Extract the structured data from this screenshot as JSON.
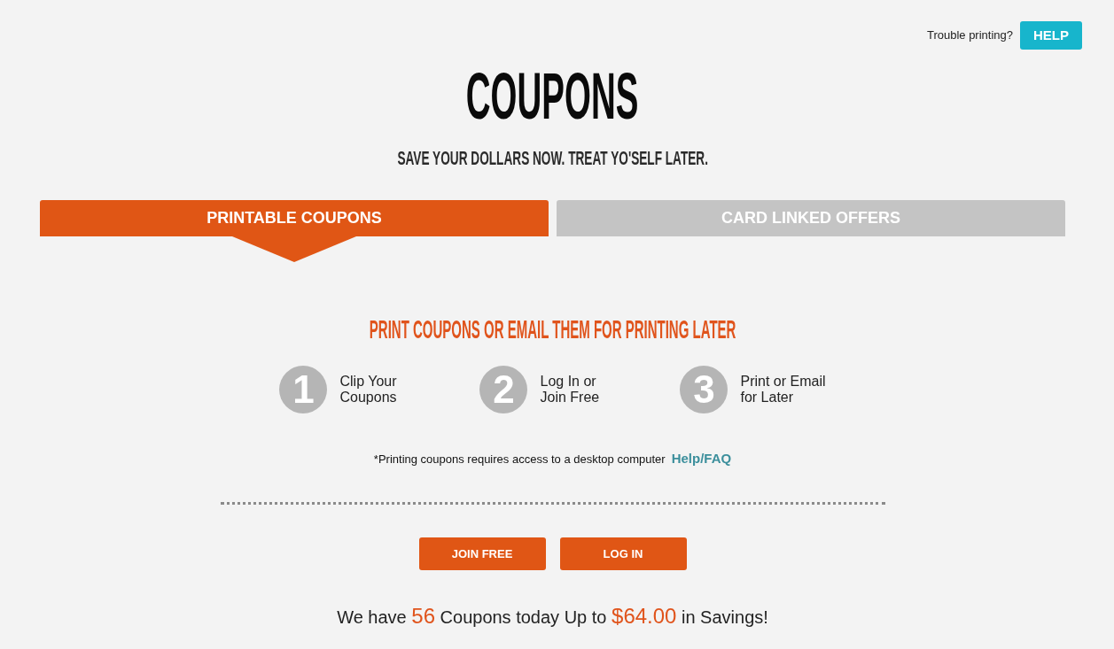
{
  "header": {
    "help_prompt": "Trouble printing?",
    "help_button": "HELP"
  },
  "title": "COUPONS",
  "tagline": "SAVE YOUR DOLLARS NOW. TREAT YO'SELF LATER.",
  "tabs": [
    {
      "label": "PRINTABLE COUPONS",
      "selected": true
    },
    {
      "label": "CARD LINKED OFFERS",
      "selected": false
    }
  ],
  "panel": {
    "heading": "PRINT COUPONS OR EMAIL THEM FOR PRINTING LATER",
    "steps": [
      {
        "number": "1",
        "text": "Clip Your\nCoupons"
      },
      {
        "number": "2",
        "text": "Log In or\nJoin Free"
      },
      {
        "number": "3",
        "text": "Print or Email\nfor Later"
      }
    ],
    "note": "*Printing coupons requires access to a desktop computer",
    "note_link": "Help/FAQ",
    "buttons": [
      "JOIN FREE",
      "LOG IN"
    ],
    "savings": [
      {
        "text": "We have",
        "highlight": false
      },
      {
        "text": "56",
        "highlight": true
      },
      {
        "text": "Coupons today Up to",
        "highlight": false
      },
      {
        "text": "$64.00",
        "highlight": true
      },
      {
        "text": "in Savings!",
        "highlight": false
      }
    ]
  }
}
